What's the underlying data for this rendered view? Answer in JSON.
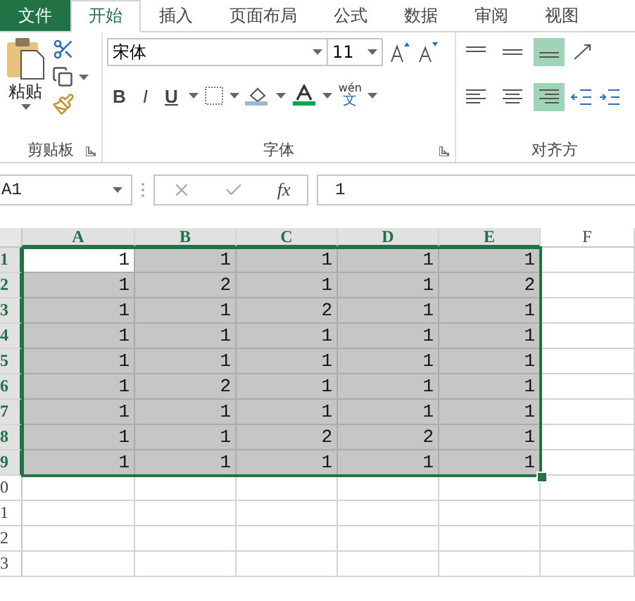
{
  "tabs": [
    {
      "label": "文件",
      "kind": "file",
      "selected": false
    },
    {
      "label": "开始",
      "kind": "tab",
      "selected": true
    },
    {
      "label": "插入",
      "kind": "tab",
      "selected": false
    },
    {
      "label": "页面布局",
      "kind": "tab",
      "selected": false
    },
    {
      "label": "公式",
      "kind": "tab",
      "selected": false
    },
    {
      "label": "数据",
      "kind": "tab",
      "selected": false
    },
    {
      "label": "审阅",
      "kind": "tab",
      "selected": false
    },
    {
      "label": "视图",
      "kind": "tab",
      "selected": false
    }
  ],
  "ribbon": {
    "clipboard": {
      "paste_label": "粘贴",
      "group_label": "剪贴板"
    },
    "font": {
      "font_name": "宋体",
      "font_size": "11",
      "bold": "B",
      "italic": "I",
      "underline": "U",
      "phonetic_top": "wén",
      "phonetic_bottom": "文",
      "group_label": "字体"
    },
    "alignment": {
      "vertical": [
        {
          "kind": "top",
          "selected": false
        },
        {
          "kind": "middle",
          "selected": false
        },
        {
          "kind": "bottom",
          "selected": true
        }
      ],
      "horizontal": [
        {
          "kind": "left",
          "selected": false
        },
        {
          "kind": "center",
          "selected": false
        },
        {
          "kind": "right",
          "selected": true
        }
      ],
      "group_label": "对齐方"
    }
  },
  "formula_bar": {
    "name_box": "A1",
    "fx": "fx",
    "value": "1"
  },
  "sheet": {
    "columns": [
      {
        "label": "A",
        "highlighted": true
      },
      {
        "label": "B",
        "highlighted": true
      },
      {
        "label": "C",
        "highlighted": true
      },
      {
        "label": "D",
        "highlighted": true
      },
      {
        "label": "E",
        "highlighted": true
      },
      {
        "label": "F",
        "highlighted": false
      }
    ],
    "rows": [
      {
        "header": "1",
        "highlighted": true,
        "cells": [
          {
            "value": "1",
            "selected": true,
            "active": true
          },
          {
            "value": "1",
            "selected": true,
            "active": false
          },
          {
            "value": "1",
            "selected": true,
            "active": false
          },
          {
            "value": "1",
            "selected": true,
            "active": false
          },
          {
            "value": "1",
            "selected": true,
            "active": false
          }
        ]
      },
      {
        "header": "2",
        "highlighted": true,
        "cells": [
          {
            "value": "1",
            "selected": true,
            "active": false
          },
          {
            "value": "2",
            "selected": true,
            "active": false
          },
          {
            "value": "1",
            "selected": true,
            "active": false
          },
          {
            "value": "1",
            "selected": true,
            "active": false
          },
          {
            "value": "2",
            "selected": true,
            "active": false
          }
        ]
      },
      {
        "header": "3",
        "highlighted": true,
        "cells": [
          {
            "value": "1",
            "selected": true,
            "active": false
          },
          {
            "value": "1",
            "selected": true,
            "active": false
          },
          {
            "value": "2",
            "selected": true,
            "active": false
          },
          {
            "value": "1",
            "selected": true,
            "active": false
          },
          {
            "value": "1",
            "selected": true,
            "active": false
          }
        ]
      },
      {
        "header": "4",
        "highlighted": true,
        "cells": [
          {
            "value": "1",
            "selected": true,
            "active": false
          },
          {
            "value": "1",
            "selected": true,
            "active": false
          },
          {
            "value": "1",
            "selected": true,
            "active": false
          },
          {
            "value": "1",
            "selected": true,
            "active": false
          },
          {
            "value": "1",
            "selected": true,
            "active": false
          }
        ]
      },
      {
        "header": "5",
        "highlighted": true,
        "cells": [
          {
            "value": "1",
            "selected": true,
            "active": false
          },
          {
            "value": "1",
            "selected": true,
            "active": false
          },
          {
            "value": "1",
            "selected": true,
            "active": false
          },
          {
            "value": "1",
            "selected": true,
            "active": false
          },
          {
            "value": "1",
            "selected": true,
            "active": false
          }
        ]
      },
      {
        "header": "6",
        "highlighted": true,
        "cells": [
          {
            "value": "1",
            "selected": true,
            "active": false
          },
          {
            "value": "2",
            "selected": true,
            "active": false
          },
          {
            "value": "1",
            "selected": true,
            "active": false
          },
          {
            "value": "1",
            "selected": true,
            "active": false
          },
          {
            "value": "1",
            "selected": true,
            "active": false
          }
        ]
      },
      {
        "header": "7",
        "highlighted": true,
        "cells": [
          {
            "value": "1",
            "selected": true,
            "active": false
          },
          {
            "value": "1",
            "selected": true,
            "active": false
          },
          {
            "value": "1",
            "selected": true,
            "active": false
          },
          {
            "value": "1",
            "selected": true,
            "active": false
          },
          {
            "value": "1",
            "selected": true,
            "active": false
          }
        ]
      },
      {
        "header": "8",
        "highlighted": true,
        "cells": [
          {
            "value": "1",
            "selected": true,
            "active": false
          },
          {
            "value": "1",
            "selected": true,
            "active": false
          },
          {
            "value": "2",
            "selected": true,
            "active": false
          },
          {
            "value": "2",
            "selected": true,
            "active": false
          },
          {
            "value": "1",
            "selected": true,
            "active": false
          }
        ]
      },
      {
        "header": "9",
        "highlighted": true,
        "cells": [
          {
            "value": "1",
            "selected": true,
            "active": false
          },
          {
            "value": "1",
            "selected": true,
            "active": false
          },
          {
            "value": "1",
            "selected": true,
            "active": false
          },
          {
            "value": "1",
            "selected": true,
            "active": false
          },
          {
            "value": "1",
            "selected": true,
            "active": false
          }
        ]
      },
      {
        "header": "0",
        "highlighted": false
      },
      {
        "header": "1",
        "highlighted": false
      },
      {
        "header": "2",
        "highlighted": false
      },
      {
        "header": "3",
        "highlighted": false
      }
    ]
  }
}
